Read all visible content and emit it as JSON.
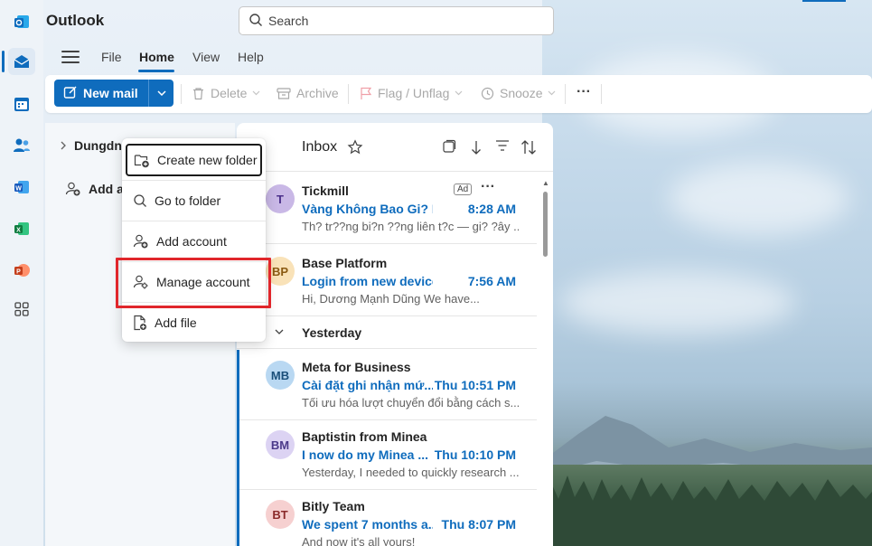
{
  "app": {
    "title": "Outlook"
  },
  "search": {
    "placeholder": "Search"
  },
  "menu_tabs": [
    "File",
    "Home",
    "View",
    "Help"
  ],
  "active_tab": "Home",
  "ribbon": {
    "new_mail": "New mail",
    "delete": "Delete",
    "archive": "Archive",
    "flag": "Flag / Unflag",
    "snooze": "Snooze",
    "more": "···"
  },
  "folder_pane": {
    "account": "Dungdn",
    "add_account": "Add a"
  },
  "context_menu": {
    "items": [
      "Create new folder",
      "Go to folder",
      "Add account",
      "Manage account",
      "Add file"
    ],
    "highlighted": "Manage account"
  },
  "inbox": {
    "title": "Inbox",
    "group_label": "Yesterday",
    "messages": [
      {
        "initials": "T",
        "sender": "Tickmill",
        "subject": "Vàng Không Bao Gi? Ng?. Tài",
        "time": "8:28 AM",
        "preview": "Th? tr??ng bi?n ??ng liên t?c — gi? ?ây ...",
        "ad": "Ad",
        "avatar_bg": "#c9b8e6",
        "avatar_fg": "#4b2f8a",
        "unread": false
      },
      {
        "initials": "BP",
        "sender": "Base Platform",
        "subject": "Login from new device",
        "time": "7:56 AM",
        "preview": "Hi, Dương Mạnh Dũng We have...",
        "avatar_bg": "#f9e2b8",
        "avatar_fg": "#8a5a12",
        "unread": false
      },
      {
        "initials": "MB",
        "sender": "Meta for Business",
        "subject": "Cài đặt ghi nhận mứ...",
        "time": "Thu 10:51 PM",
        "preview": "Tối ưu hóa lượt chuyển đổi bằng cách s...",
        "avatar_bg": "#b9d8f2",
        "avatar_fg": "#1a4f7a",
        "unread": true
      },
      {
        "initials": "BM",
        "sender": "Baptistin from Minea",
        "subject": "I now do my Minea ...",
        "time": "Thu 10:10 PM",
        "preview": "Yesterday, I needed to quickly research ...",
        "avatar_bg": "#dcd3f3",
        "avatar_fg": "#4b3a8a",
        "unread": true
      },
      {
        "initials": "BT",
        "sender": "Bitly Team",
        "subject": "We spent 7 months a...",
        "time": "Thu 8:07 PM",
        "preview": "And now it's all yours!",
        "avatar_bg": "#f6d0d0",
        "avatar_fg": "#8a2a2a",
        "unread": true
      }
    ]
  },
  "colors": {
    "accent": "#0f6cbd",
    "highlight_box": "#e0262b"
  }
}
